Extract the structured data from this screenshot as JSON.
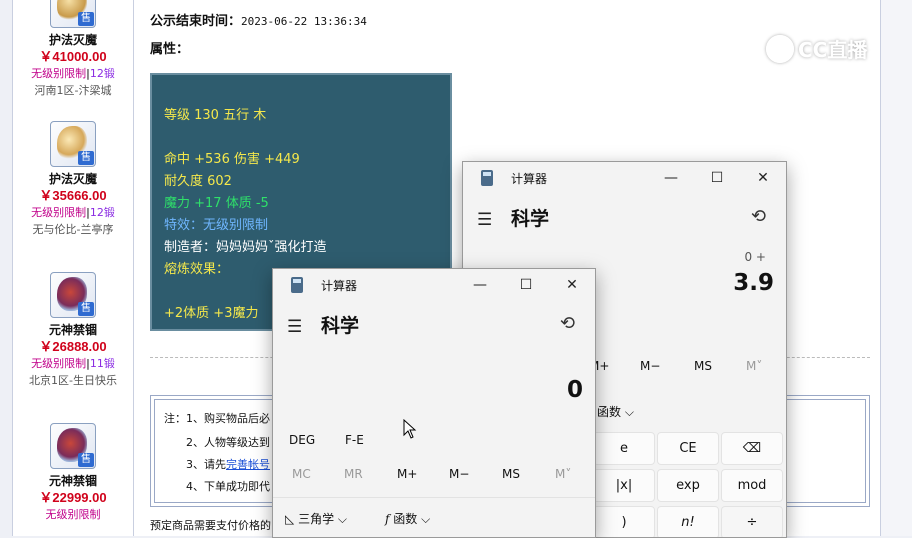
{
  "sidebar": {
    "items": [
      {
        "name": "护法灭魔",
        "price": "￥41000.00",
        "limit": "无级别限制",
        "forge": "12锻",
        "location": "河南1区-汴梁城"
      },
      {
        "name": "护法灭魔",
        "price": "￥35666.00",
        "limit": "无级别限制",
        "forge": "12锻",
        "location": "无与伦比-兰亭序"
      },
      {
        "name": "元神禁锢",
        "price": "￥26888.00",
        "limit": "无级别限制",
        "forge": "11锻",
        "location": "北京1区-生日快乐"
      },
      {
        "name": "元神禁锢",
        "price": "￥22999.00",
        "limit": "无级别限制",
        "forge": "",
        "location": ""
      }
    ],
    "sell_badge": "售"
  },
  "detail": {
    "end_time_label": "公示结束时间：",
    "end_time_value": "2023-06-22 13:36:34",
    "attr_label": "属性：",
    "attributes": [
      {
        "text": "等级 130 五行 木",
        "color": "#f5e84b"
      },
      {
        "text": "命中 +536 伤害 +449",
        "color": "#f5e84b"
      },
      {
        "text": "耐久度 602",
        "color": "#f5e84b"
      },
      {
        "text": "魔力 +17 体质 -5",
        "color": "#2fe06a"
      },
      {
        "text": "特效：无级别限制",
        "color": "#6fb6ff"
      },
      {
        "text": "制造者：妈妈妈妈ˇ强化打造",
        "color": "#ffffff"
      },
      {
        "text": "熔炼效果：",
        "color": "#f5e84b"
      },
      {
        "text": "+2体质 +3魔力",
        "color": "#f5e84b"
      }
    ]
  },
  "notes": {
    "n1": "注：1、购买物品后必",
    "n2": "2、人物等级达到",
    "n3_prefix": "3、请先",
    "n3_link": "完善帐号",
    "n4": "4、下单成功即代",
    "footer": "预定商品需要支付价格的"
  },
  "watermark": {
    "text": "CC直播"
  },
  "calc_back": {
    "title": "计算器",
    "mode": "科学",
    "expression": "0 +",
    "display": "3.9",
    "memory": [
      "M+",
      "M−",
      "MS",
      "M˅"
    ],
    "func_label": "函数",
    "keys": [
      "e",
      "CE",
      "⌫",
      "|x|",
      "exp",
      "mod",
      ")",
      "n!",
      "÷"
    ]
  },
  "calc_front": {
    "title": "计算器",
    "mode": "科学",
    "display": "0",
    "angle": "DEG",
    "fe": "F-E",
    "memory": [
      "MC",
      "MR",
      "M+",
      "M−",
      "MS",
      "M˅"
    ],
    "trig_label": "三角学",
    "func_label": "函数"
  }
}
